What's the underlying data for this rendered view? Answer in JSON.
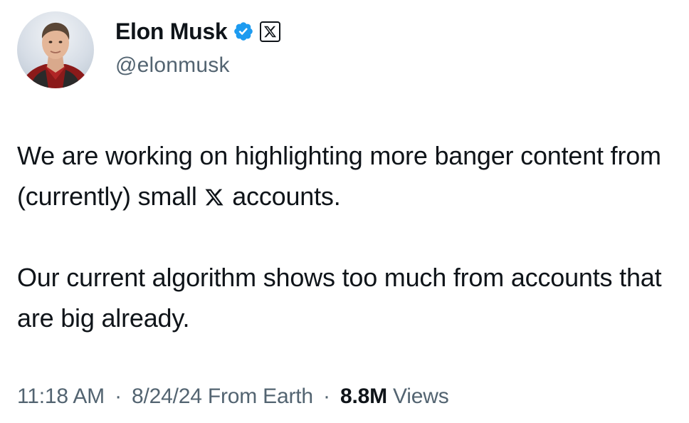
{
  "author": {
    "display_name": "Elon Musk",
    "handle": "@elonmusk",
    "verified": true,
    "badges": [
      "verified-check-icon",
      "x-logo-icon"
    ]
  },
  "tweet": {
    "paragraph_1_before_icon": "We are working on highlighting more banger content from (currently) small ",
    "paragraph_1_after_icon": " accounts.",
    "paragraph_1_inline_icon": "x-logo-icon",
    "paragraph_2": "Our current algorithm shows too much from accounts that are big already."
  },
  "meta": {
    "time": "11:18 AM",
    "separator": "·",
    "date": "8/24/24",
    "source": "From Earth",
    "views_count": "8.8M",
    "views_label": "Views"
  },
  "colors": {
    "text_primary": "#0f1419",
    "text_secondary": "#536471",
    "verified_blue": "#1d9bf0",
    "background": "#ffffff"
  }
}
